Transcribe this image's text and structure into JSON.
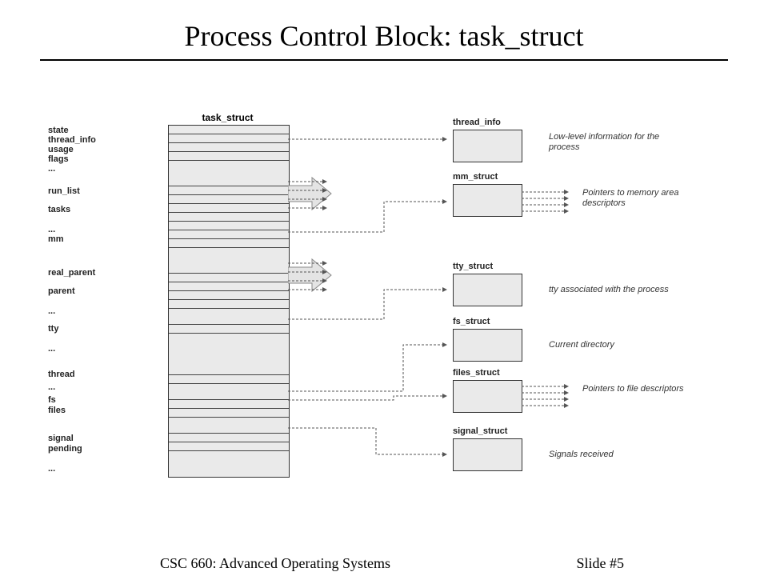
{
  "title": "Process Control Block: task_struct",
  "footer_left": "CSC 660: Advanced Operating Systems",
  "footer_right": "Slide #5",
  "struct_label": "task_struct",
  "fields": {
    "f0": "state",
    "f1": "thread_info",
    "f2": "usage",
    "f3": "flags",
    "f4": "...",
    "f5": "run_list",
    "f6": "tasks",
    "f7": "...",
    "f8": "mm",
    "f9": "real_parent",
    "f10": "parent",
    "f11": "...",
    "f12": "tty",
    "f13": "...",
    "f14": "thread",
    "f15": "...",
    "f16": "fs",
    "f17": "files",
    "f18": "signal",
    "f19": "pending",
    "f20": "..."
  },
  "ext": {
    "e0": {
      "label": "thread_info",
      "desc": "Low-level information for the process"
    },
    "e1": {
      "label": "mm_struct",
      "desc": "Pointers to memory area descriptors"
    },
    "e2": {
      "label": "tty_struct",
      "desc": "tty associated with the process"
    },
    "e3": {
      "label": "fs_struct",
      "desc": "Current directory"
    },
    "e4": {
      "label": "files_struct",
      "desc": "Pointers to file descriptors"
    },
    "e5": {
      "label": "signal_struct",
      "desc": "Signals received"
    }
  }
}
